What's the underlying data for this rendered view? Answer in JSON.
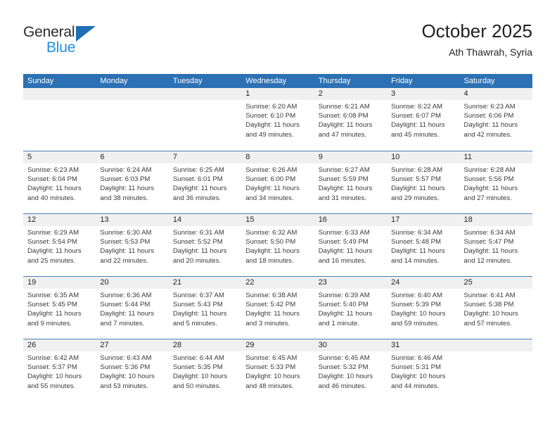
{
  "brand": {
    "name_top": "General",
    "name_bottom": "Blue",
    "triangle_color": "#1f6fb5",
    "blue_text_color": "#1f8fe0"
  },
  "header": {
    "title": "October 2025",
    "subtitle": "Ath Thawrah, Syria"
  },
  "theme": {
    "header_bg": "#2c71b4",
    "row_divider": "#4a7fb5",
    "date_band_bg": "#f0f0f0",
    "text": "#231f20"
  },
  "weekdays": [
    "Sunday",
    "Monday",
    "Tuesday",
    "Wednesday",
    "Thursday",
    "Friday",
    "Saturday"
  ],
  "labels": {
    "sunrise": "Sunrise:",
    "sunset": "Sunset:",
    "daylight": "Daylight:"
  },
  "weeks": [
    [
      {
        "day": "",
        "empty": true
      },
      {
        "day": "",
        "empty": true
      },
      {
        "day": "",
        "empty": true
      },
      {
        "day": "1",
        "sunrise": "Sunrise: 6:20 AM",
        "sunset": "Sunset: 6:10 PM",
        "daylight": "Daylight: 11 hours and 49 minutes."
      },
      {
        "day": "2",
        "sunrise": "Sunrise: 6:21 AM",
        "sunset": "Sunset: 6:08 PM",
        "daylight": "Daylight: 11 hours and 47 minutes."
      },
      {
        "day": "3",
        "sunrise": "Sunrise: 6:22 AM",
        "sunset": "Sunset: 6:07 PM",
        "daylight": "Daylight: 11 hours and 45 minutes."
      },
      {
        "day": "4",
        "sunrise": "Sunrise: 6:23 AM",
        "sunset": "Sunset: 6:06 PM",
        "daylight": "Daylight: 11 hours and 42 minutes."
      }
    ],
    [
      {
        "day": "5",
        "sunrise": "Sunrise: 6:23 AM",
        "sunset": "Sunset: 6:04 PM",
        "daylight": "Daylight: 11 hours and 40 minutes."
      },
      {
        "day": "6",
        "sunrise": "Sunrise: 6:24 AM",
        "sunset": "Sunset: 6:03 PM",
        "daylight": "Daylight: 11 hours and 38 minutes."
      },
      {
        "day": "7",
        "sunrise": "Sunrise: 6:25 AM",
        "sunset": "Sunset: 6:01 PM",
        "daylight": "Daylight: 11 hours and 36 minutes."
      },
      {
        "day": "8",
        "sunrise": "Sunrise: 6:26 AM",
        "sunset": "Sunset: 6:00 PM",
        "daylight": "Daylight: 11 hours and 34 minutes."
      },
      {
        "day": "9",
        "sunrise": "Sunrise: 6:27 AM",
        "sunset": "Sunset: 5:59 PM",
        "daylight": "Daylight: 11 hours and 31 minutes."
      },
      {
        "day": "10",
        "sunrise": "Sunrise: 6:28 AM",
        "sunset": "Sunset: 5:57 PM",
        "daylight": "Daylight: 11 hours and 29 minutes."
      },
      {
        "day": "11",
        "sunrise": "Sunrise: 6:28 AM",
        "sunset": "Sunset: 5:56 PM",
        "daylight": "Daylight: 11 hours and 27 minutes."
      }
    ],
    [
      {
        "day": "12",
        "sunrise": "Sunrise: 6:29 AM",
        "sunset": "Sunset: 5:54 PM",
        "daylight": "Daylight: 11 hours and 25 minutes."
      },
      {
        "day": "13",
        "sunrise": "Sunrise: 6:30 AM",
        "sunset": "Sunset: 5:53 PM",
        "daylight": "Daylight: 11 hours and 22 minutes."
      },
      {
        "day": "14",
        "sunrise": "Sunrise: 6:31 AM",
        "sunset": "Sunset: 5:52 PM",
        "daylight": "Daylight: 11 hours and 20 minutes."
      },
      {
        "day": "15",
        "sunrise": "Sunrise: 6:32 AM",
        "sunset": "Sunset: 5:50 PM",
        "daylight": "Daylight: 11 hours and 18 minutes."
      },
      {
        "day": "16",
        "sunrise": "Sunrise: 6:33 AM",
        "sunset": "Sunset: 5:49 PM",
        "daylight": "Daylight: 11 hours and 16 minutes."
      },
      {
        "day": "17",
        "sunrise": "Sunrise: 6:34 AM",
        "sunset": "Sunset: 5:48 PM",
        "daylight": "Daylight: 11 hours and 14 minutes."
      },
      {
        "day": "18",
        "sunrise": "Sunrise: 6:34 AM",
        "sunset": "Sunset: 5:47 PM",
        "daylight": "Daylight: 11 hours and 12 minutes."
      }
    ],
    [
      {
        "day": "19",
        "sunrise": "Sunrise: 6:35 AM",
        "sunset": "Sunset: 5:45 PM",
        "daylight": "Daylight: 11 hours and 9 minutes."
      },
      {
        "day": "20",
        "sunrise": "Sunrise: 6:36 AM",
        "sunset": "Sunset: 5:44 PM",
        "daylight": "Daylight: 11 hours and 7 minutes."
      },
      {
        "day": "21",
        "sunrise": "Sunrise: 6:37 AM",
        "sunset": "Sunset: 5:43 PM",
        "daylight": "Daylight: 11 hours and 5 minutes."
      },
      {
        "day": "22",
        "sunrise": "Sunrise: 6:38 AM",
        "sunset": "Sunset: 5:42 PM",
        "daylight": "Daylight: 11 hours and 3 minutes."
      },
      {
        "day": "23",
        "sunrise": "Sunrise: 6:39 AM",
        "sunset": "Sunset: 5:40 PM",
        "daylight": "Daylight: 11 hours and 1 minute."
      },
      {
        "day": "24",
        "sunrise": "Sunrise: 6:40 AM",
        "sunset": "Sunset: 5:39 PM",
        "daylight": "Daylight: 10 hours and 59 minutes."
      },
      {
        "day": "25",
        "sunrise": "Sunrise: 6:41 AM",
        "sunset": "Sunset: 5:38 PM",
        "daylight": "Daylight: 10 hours and 57 minutes."
      }
    ],
    [
      {
        "day": "26",
        "sunrise": "Sunrise: 6:42 AM",
        "sunset": "Sunset: 5:37 PM",
        "daylight": "Daylight: 10 hours and 55 minutes."
      },
      {
        "day": "27",
        "sunrise": "Sunrise: 6:43 AM",
        "sunset": "Sunset: 5:36 PM",
        "daylight": "Daylight: 10 hours and 53 minutes."
      },
      {
        "day": "28",
        "sunrise": "Sunrise: 6:44 AM",
        "sunset": "Sunset: 5:35 PM",
        "daylight": "Daylight: 10 hours and 50 minutes."
      },
      {
        "day": "29",
        "sunrise": "Sunrise: 6:45 AM",
        "sunset": "Sunset: 5:33 PM",
        "daylight": "Daylight: 10 hours and 48 minutes."
      },
      {
        "day": "30",
        "sunrise": "Sunrise: 6:45 AM",
        "sunset": "Sunset: 5:32 PM",
        "daylight": "Daylight: 10 hours and 46 minutes."
      },
      {
        "day": "31",
        "sunrise": "Sunrise: 6:46 AM",
        "sunset": "Sunset: 5:31 PM",
        "daylight": "Daylight: 10 hours and 44 minutes."
      },
      {
        "day": "",
        "empty": true
      }
    ]
  ]
}
